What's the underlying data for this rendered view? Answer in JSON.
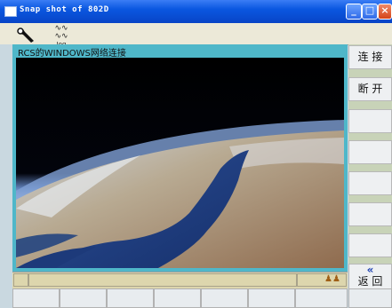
{
  "window": {
    "title": "Snap shot of 802D"
  },
  "toolbar": {
    "wrench_icon": "wrench-icon",
    "jog_label": "Jog",
    "jog_icon": "jog-wave-icon"
  },
  "viewport": {
    "header": "RCS的WINDOWS网络连接"
  },
  "sidebar": {
    "buttons": [
      "连 接",
      "断 开",
      "",
      "",
      "",
      "",
      "",
      ""
    ],
    "back_label": "返 回",
    "back_icon": "double-chevron-left-icon"
  },
  "statusbar": {
    "icon": "network-users-icon"
  },
  "colors": {
    "title_bar": "#0a57e0",
    "viewport_frame": "#4fb7c9",
    "status_bar": "#ddd6ad",
    "side_panel": "#c8d3b8"
  }
}
